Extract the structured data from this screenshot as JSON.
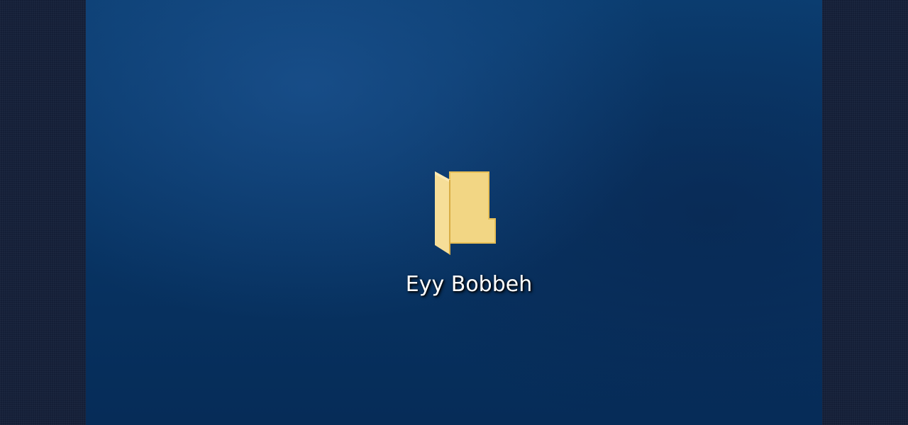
{
  "desktop": {
    "background_color": "#083565",
    "icons": [
      {
        "label": "Eyy Bobbeh",
        "icon": "folder-icon",
        "icon_color": "#f3d78a"
      }
    ]
  }
}
